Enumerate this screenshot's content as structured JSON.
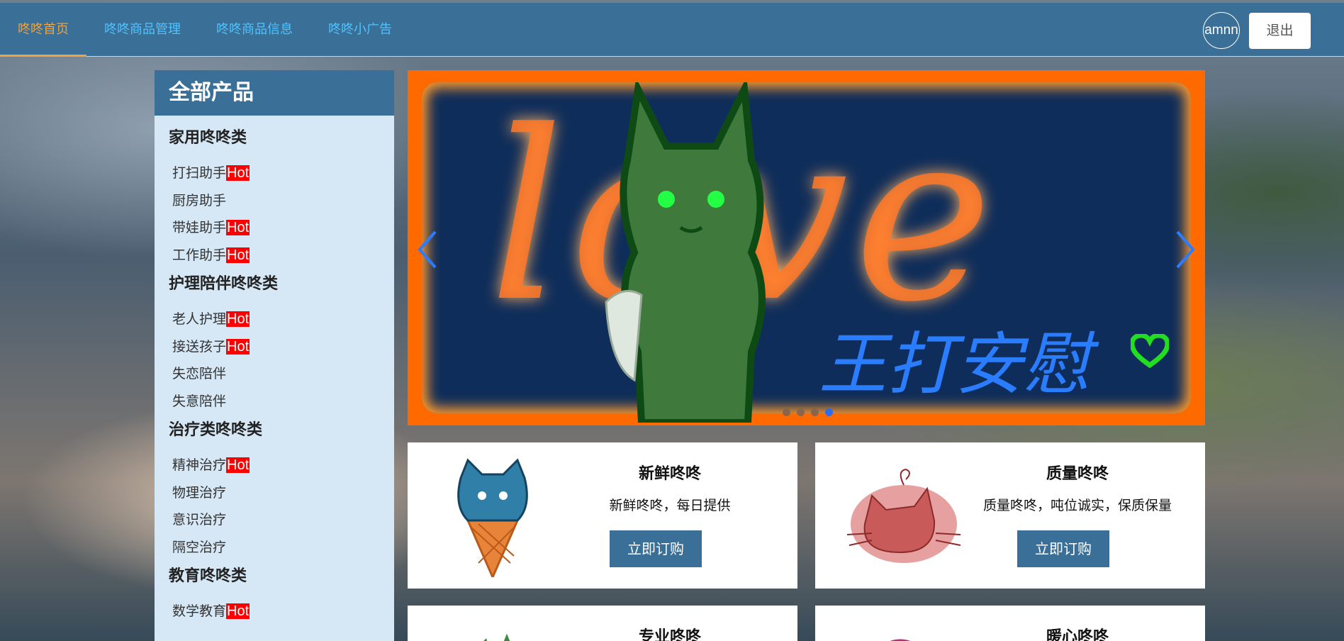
{
  "nav": {
    "items": [
      {
        "label": "咚咚首页"
      },
      {
        "label": "咚咚商品管理"
      },
      {
        "label": "咚咚商品信息"
      },
      {
        "label": "咚咚小广告"
      }
    ],
    "active_index": 0
  },
  "user": {
    "avatar_text": "amnn",
    "logout_label": "退出"
  },
  "sidebar": {
    "title": "全部产品",
    "categories": [
      {
        "title": "家用咚咚类",
        "items": [
          {
            "label": "打扫助手",
            "hot": "Hot"
          },
          {
            "label": "厨房助手",
            "hot": ""
          },
          {
            "label": "带娃助手",
            "hot": "Hot"
          },
          {
            "label": "工作助手",
            "hot": "Hot"
          }
        ]
      },
      {
        "title": "护理陪伴咚咚类",
        "items": [
          {
            "label": "老人护理",
            "hot": "Hot"
          },
          {
            "label": "接送孩子",
            "hot": "Hot"
          },
          {
            "label": "失恋陪伴",
            "hot": ""
          },
          {
            "label": "失意陪伴",
            "hot": ""
          }
        ]
      },
      {
        "title": "治疗类咚咚类",
        "items": [
          {
            "label": "精神治疗",
            "hot": "Hot"
          },
          {
            "label": "物理治疗",
            "hot": ""
          },
          {
            "label": "意识治疗",
            "hot": ""
          },
          {
            "label": "隔空治疗",
            "hot": ""
          }
        ]
      },
      {
        "title": "教育咚咚类",
        "items": [
          {
            "label": "数学教育",
            "hot": "Hot"
          }
        ]
      }
    ]
  },
  "carousel": {
    "slide_text": "love",
    "signature": "王打安慰",
    "slide_count": 4,
    "active_slide": 4
  },
  "cards": [
    {
      "title": "新鲜咚咚",
      "desc": "新鲜咚咚，每日提供",
      "button": "立即订购",
      "icon": "blue-cat-icecream"
    },
    {
      "title": "质量咚咚",
      "desc": "质量咚咚，吨位诚实，保质保量",
      "button": "立即订购",
      "icon": "red-cat-blob"
    },
    {
      "title": "专业咚咚",
      "desc": "",
      "button": "",
      "icon": "green-sprout"
    },
    {
      "title": "暖心咚咚",
      "desc": "",
      "button": "",
      "icon": "pink-cat"
    }
  ],
  "colors": {
    "header_bg": "#3a6f97",
    "nav_text": "#4fc3ff",
    "nav_active": "#f0a23c",
    "sidebar_bg": "#d6e7f6",
    "hot_bg": "#ff0000",
    "carousel_frame": "#ff6a00",
    "dot_active": "#2b6df0"
  }
}
